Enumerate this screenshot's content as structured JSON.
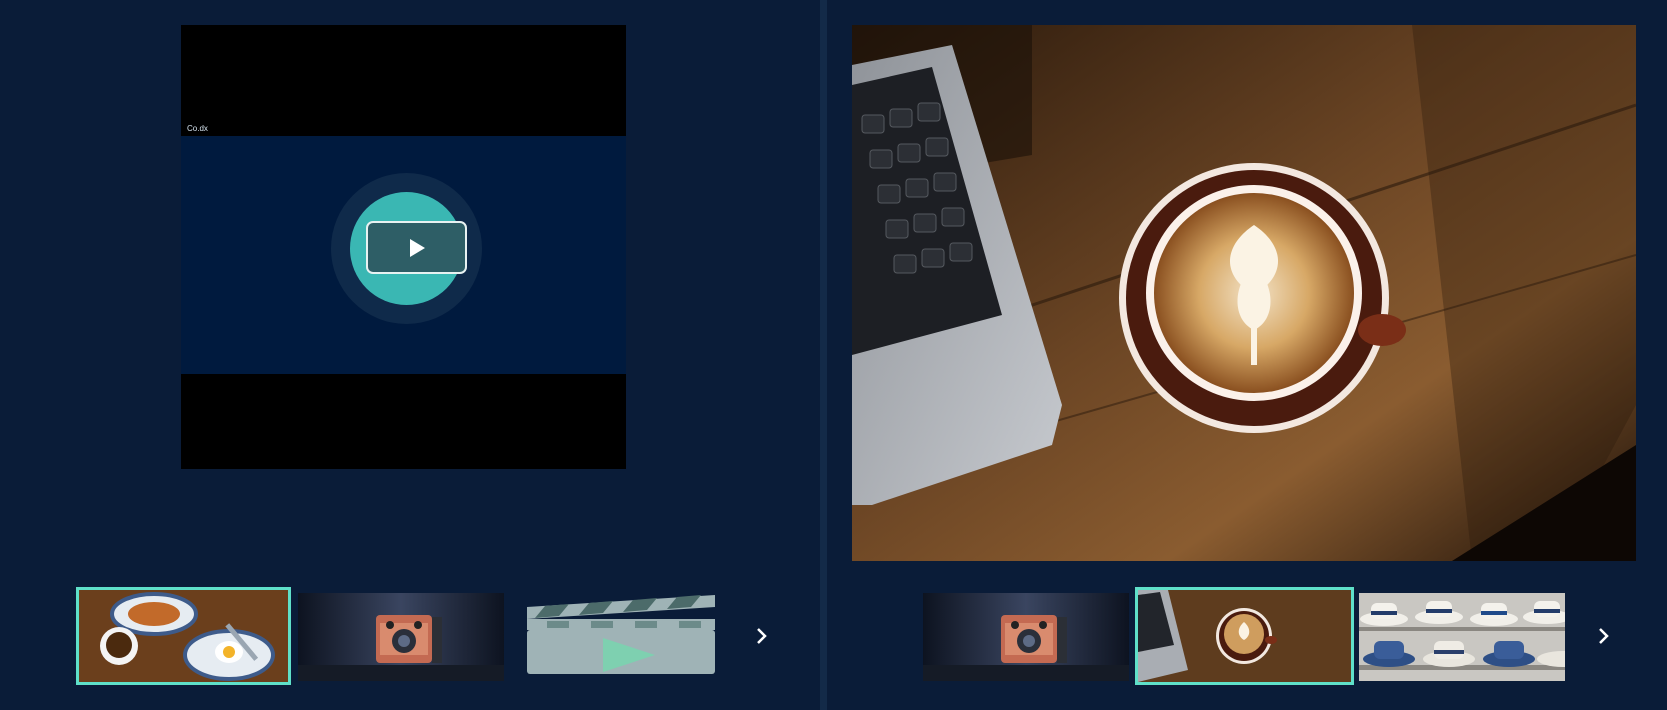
{
  "left_player": {
    "caption": "Co.dx",
    "play_label": "Play"
  },
  "left_thumbnails": [
    {
      "name": "breakfast-plates",
      "selected": true
    },
    {
      "name": "vintage-camera",
      "selected": false
    },
    {
      "name": "video-clapperboard",
      "selected": false
    }
  ],
  "right_thumbnails": [
    {
      "name": "vintage-camera",
      "selected": false
    },
    {
      "name": "latte-laptop",
      "selected": true
    },
    {
      "name": "hats-shelf",
      "selected": false
    }
  ],
  "colors": {
    "background": "#0a1c38",
    "accent": "#5fe0c9",
    "play_circle": "#3ab7b3"
  },
  "icons": {
    "next": "chevron-right-icon",
    "play": "play-icon"
  }
}
